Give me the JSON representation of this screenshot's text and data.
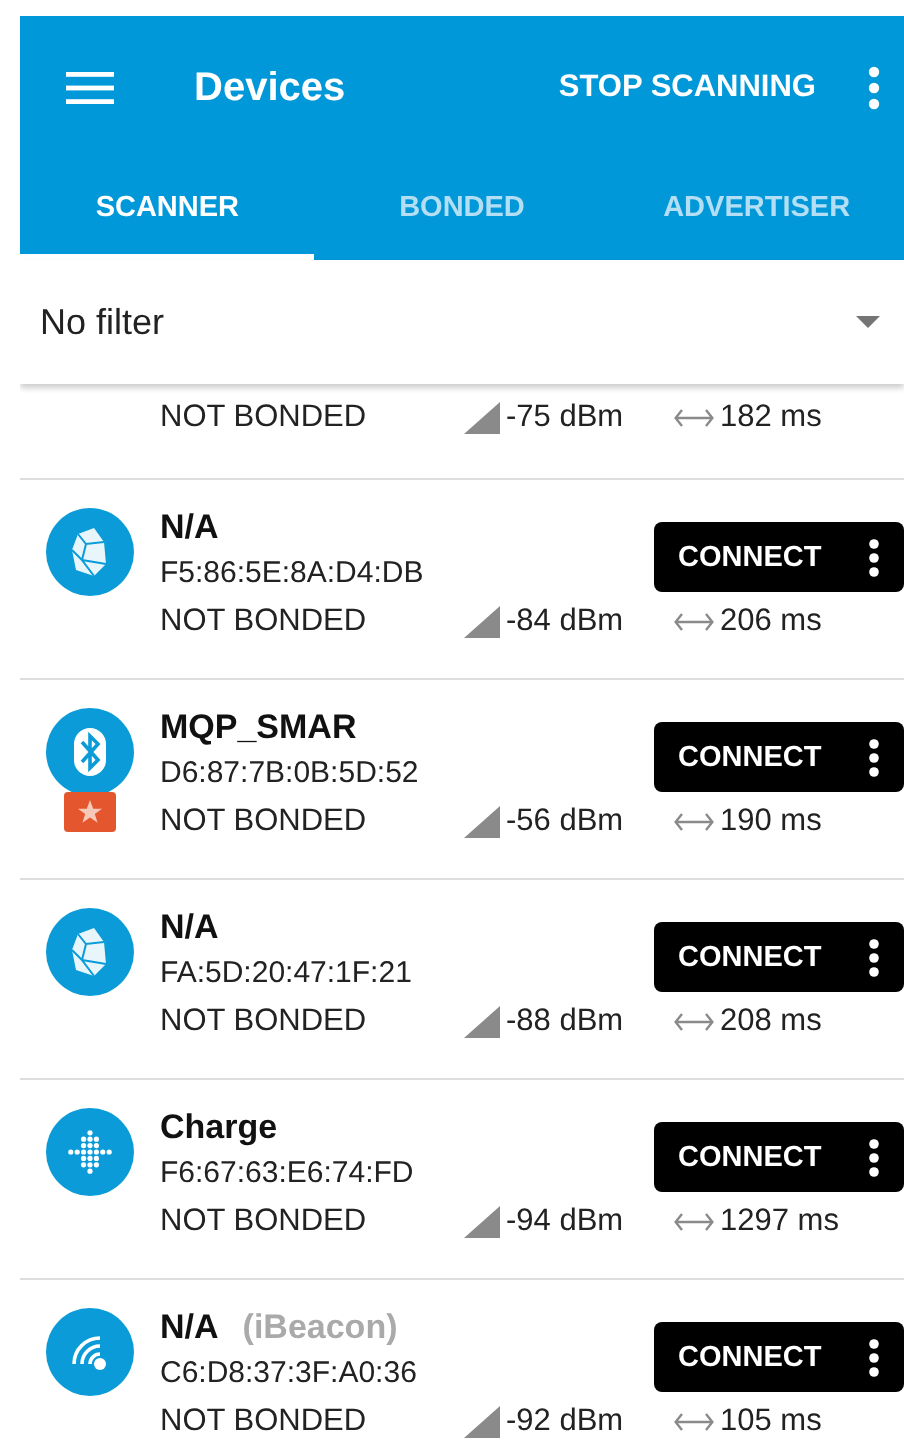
{
  "toolbar": {
    "title": "Devices",
    "action": "STOP SCANNING"
  },
  "tabs": [
    {
      "label": "SCANNER",
      "selected": true
    },
    {
      "label": "BONDED",
      "selected": false
    },
    {
      "label": "ADVERTISER",
      "selected": false
    }
  ],
  "filter": {
    "value": "No filter"
  },
  "devices": [
    {
      "kind": "partial",
      "bond": "NOT BONDED",
      "rssi": "-75 dBm",
      "interval": "182 ms"
    },
    {
      "kind": "rock",
      "name": "N/A",
      "address": "F5:86:5E:8A:D4:DB",
      "bond": "NOT BONDED",
      "rssi": "-84 dBm",
      "interval": "206 ms",
      "button": "CONNECT",
      "favorite": false
    },
    {
      "kind": "bluetooth",
      "name": "MQP_SMAR",
      "address": "D6:87:7B:0B:5D:52",
      "bond": "NOT BONDED",
      "rssi": "-56 dBm",
      "interval": "190 ms",
      "button": "CONNECT",
      "favorite": true
    },
    {
      "kind": "rock",
      "name": "N/A",
      "address": "FA:5D:20:47:1F:21",
      "bond": "NOT BONDED",
      "rssi": "-88 dBm",
      "interval": "208 ms",
      "button": "CONNECT",
      "favorite": false
    },
    {
      "kind": "fitbit",
      "name": "Charge",
      "address": "F6:67:63:E6:74:FD",
      "bond": "NOT BONDED",
      "rssi": "-94 dBm",
      "interval": "1297 ms",
      "button": "CONNECT",
      "favorite": false
    },
    {
      "kind": "beacon",
      "name": "N/A",
      "type": "(iBeacon)",
      "address": "C6:D8:37:3F:A0:36",
      "bond": "NOT BONDED",
      "rssi": "-92 dBm",
      "interval": "105 ms",
      "button": "CONNECT",
      "favorite": false
    }
  ]
}
